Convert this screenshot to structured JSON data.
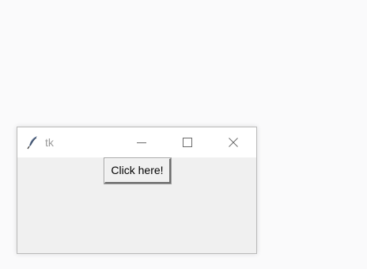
{
  "window": {
    "title": "tk",
    "app_icon": "feather-icon",
    "controls": {
      "minimize_icon": "minimize-icon",
      "maximize_icon": "maximize-icon",
      "close_icon": "close-icon"
    }
  },
  "main": {
    "button_label": "Click here!"
  },
  "colors": {
    "desktop": "#fafafb",
    "titlebar": "#ffffff",
    "client": "#f0f0f0",
    "title_text": "#9a9a9a"
  }
}
